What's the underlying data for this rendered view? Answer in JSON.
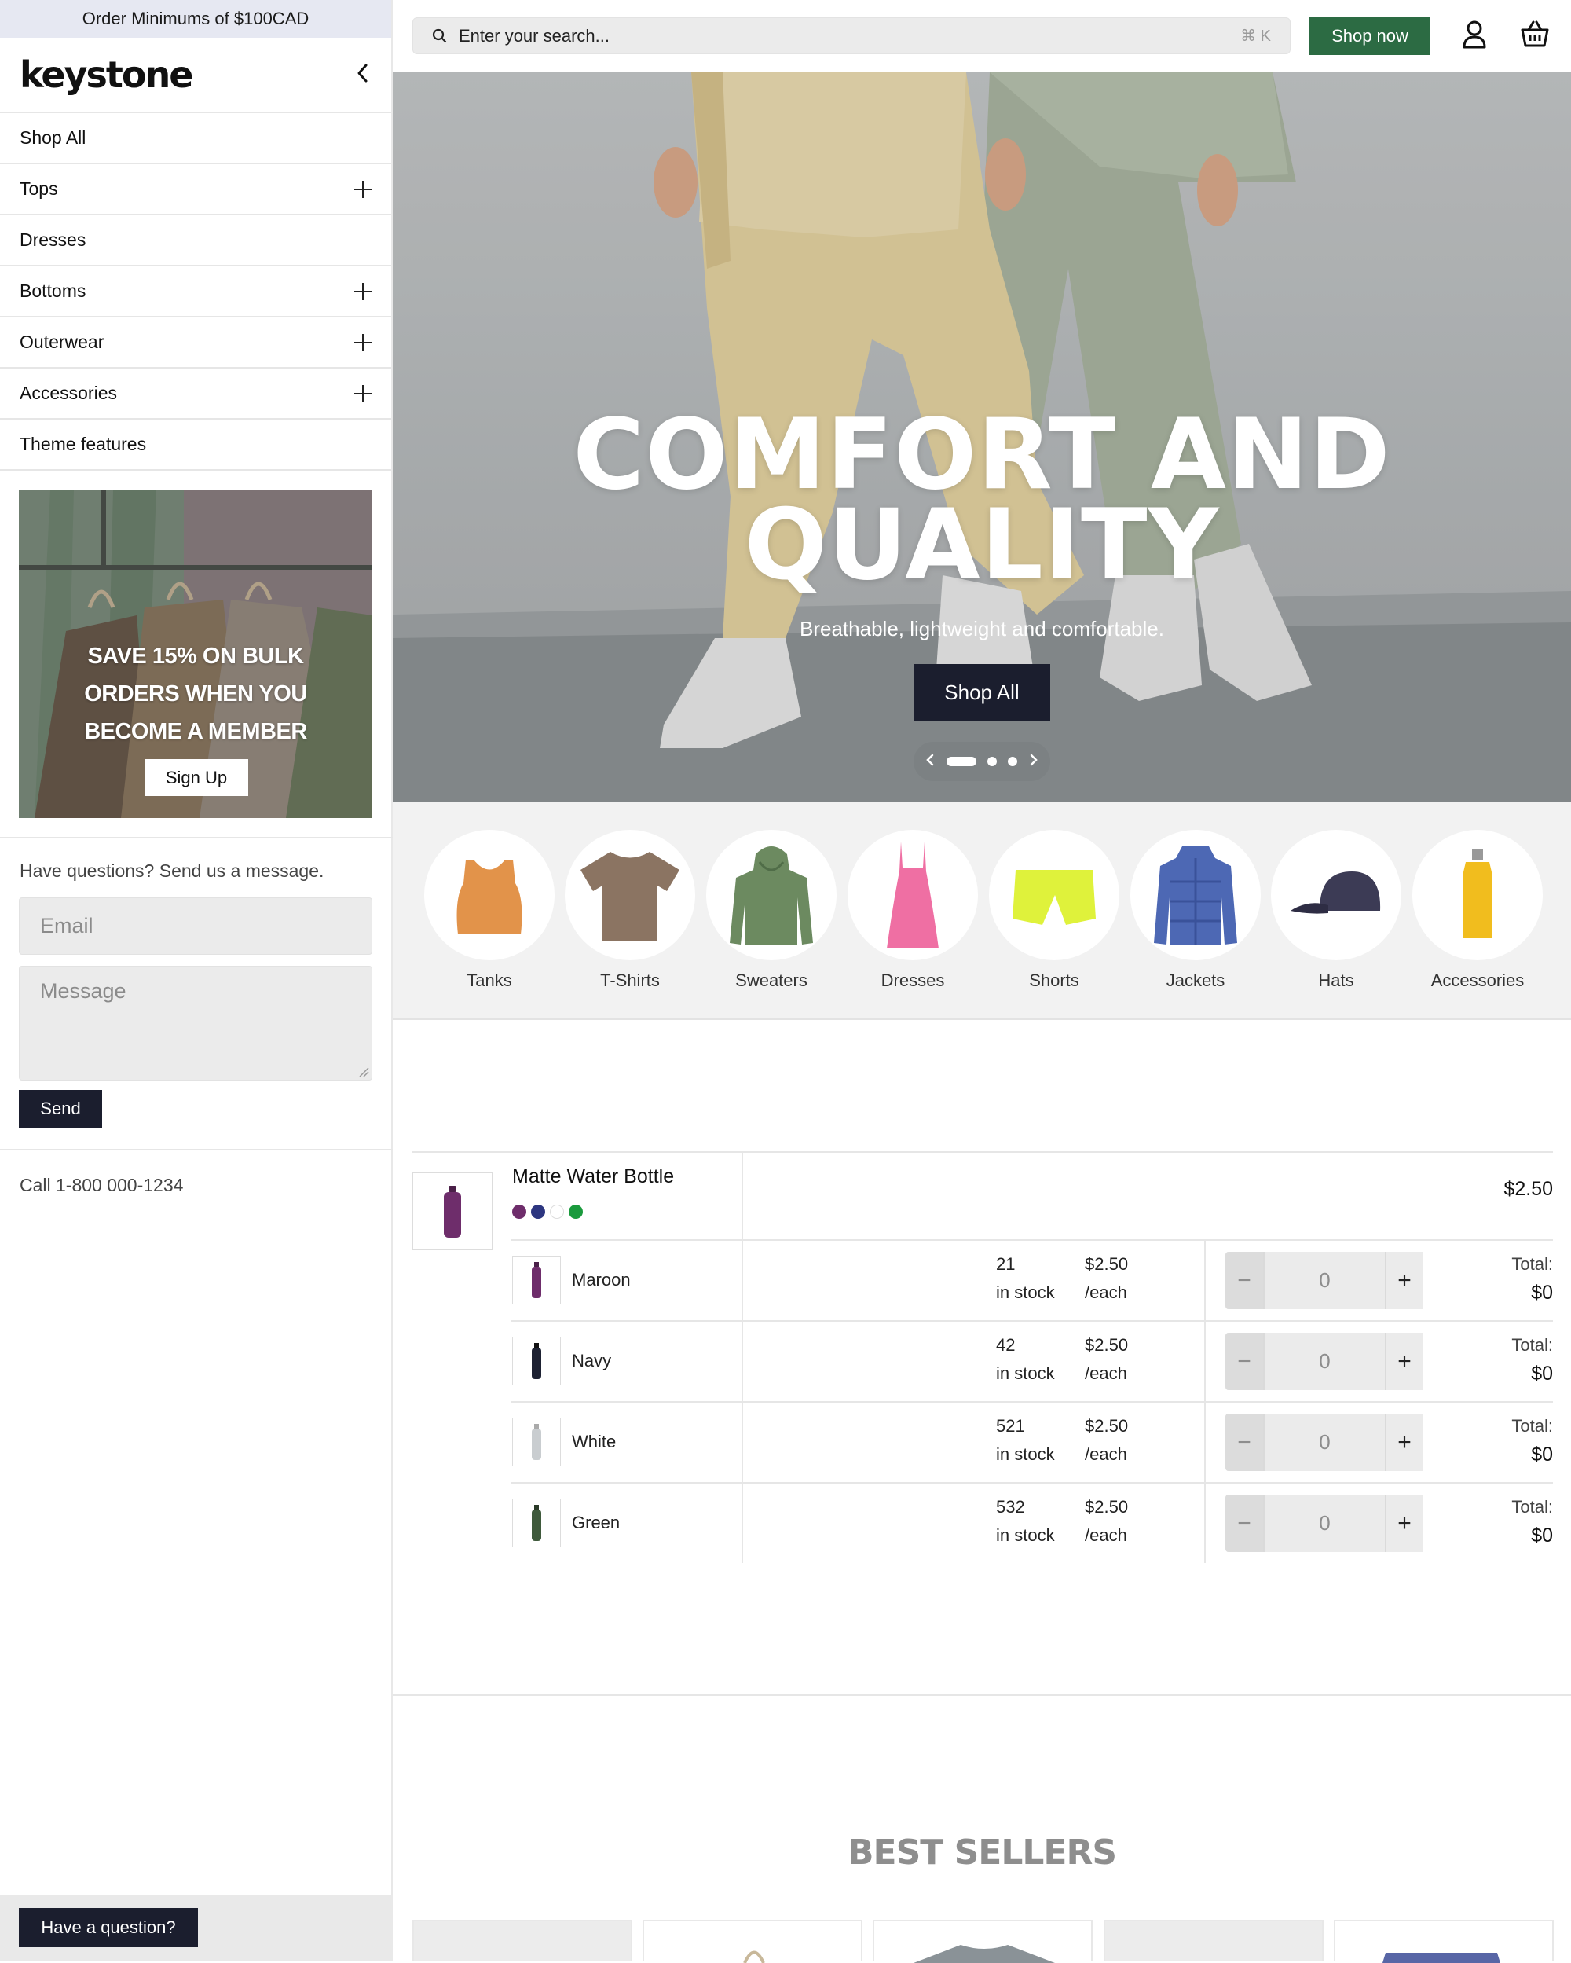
{
  "announcement": "Order Minimums of $100CAD",
  "brand": "keystone",
  "sidebar": {
    "nav": [
      {
        "label": "Shop All",
        "expandable": false
      },
      {
        "label": "Tops",
        "expandable": true
      },
      {
        "label": "Dresses",
        "expandable": false
      },
      {
        "label": "Bottoms",
        "expandable": true
      },
      {
        "label": "Outerwear",
        "expandable": true
      },
      {
        "label": "Accessories",
        "expandable": true
      },
      {
        "label": "Theme features",
        "expandable": false
      }
    ],
    "promo": {
      "line1": "SAVE 15% ON BULK",
      "line2": "ORDERS WHEN YOU",
      "line3": "BECOME A MEMBER",
      "button": "Sign Up"
    },
    "contact": {
      "title": "Have questions? Send us a message.",
      "email_placeholder": "Email",
      "message_placeholder": "Message",
      "send": "Send",
      "phone": "Call 1-800 000-1234"
    },
    "question_button": "Have a question?"
  },
  "header": {
    "search_placeholder": "Enter your search...",
    "search_shortcut": "⌘ K",
    "shop_now": "Shop now",
    "icons": [
      "search-icon",
      "user-icon",
      "basket-icon"
    ]
  },
  "hero": {
    "title_line1": "COMFORT AND",
    "title_line2": "QUALITY",
    "subtitle": "Breathable, lightweight and comfortable.",
    "cta": "Shop All",
    "slides": 3,
    "active_slide": 1
  },
  "categories": [
    {
      "label": "Tanks",
      "color": "#e2934a"
    },
    {
      "label": "T-Shirts",
      "color": "#8b7462"
    },
    {
      "label": "Sweaters",
      "color": "#6c8a60"
    },
    {
      "label": "Dresses",
      "color": "#ef6fa3"
    },
    {
      "label": "Shorts",
      "color": "#dff23b"
    },
    {
      "label": "Jackets",
      "color": "#4d68b4"
    },
    {
      "label": "Hats",
      "color": "#3c3b55"
    },
    {
      "label": "Accessories",
      "color": "#f1bd1e"
    }
  ],
  "product": {
    "name": "Matte Water Bottle",
    "price": "$2.50",
    "swatches": [
      "#6e2d6b",
      "#2d3680",
      "#ffffff",
      "#1a9a3d"
    ],
    "variants": [
      {
        "name": "Maroon",
        "stock": "21",
        "stock_label": "in stock",
        "price": "$2.50",
        "per": "/each",
        "qty": "0",
        "total_label": "Total:",
        "total": "$0",
        "color": "#6e2d6b"
      },
      {
        "name": "Navy",
        "stock": "42",
        "stock_label": "in stock",
        "price": "$2.50",
        "per": "/each",
        "qty": "0",
        "total_label": "Total:",
        "total": "$0",
        "color": "#1e2233"
      },
      {
        "name": "White",
        "stock": "521",
        "stock_label": "in stock",
        "price": "$2.50",
        "per": "/each",
        "qty": "0",
        "total_label": "Total:",
        "total": "$0",
        "color": "#c9cdd0"
      },
      {
        "name": "Green",
        "stock": "532",
        "stock_label": "in stock",
        "price": "$2.50",
        "per": "/each",
        "qty": "0",
        "total_label": "Total:",
        "total": "$0",
        "color": "#3f5a3c"
      }
    ]
  },
  "best_sellers": {
    "title": "BEST SELLERS"
  }
}
